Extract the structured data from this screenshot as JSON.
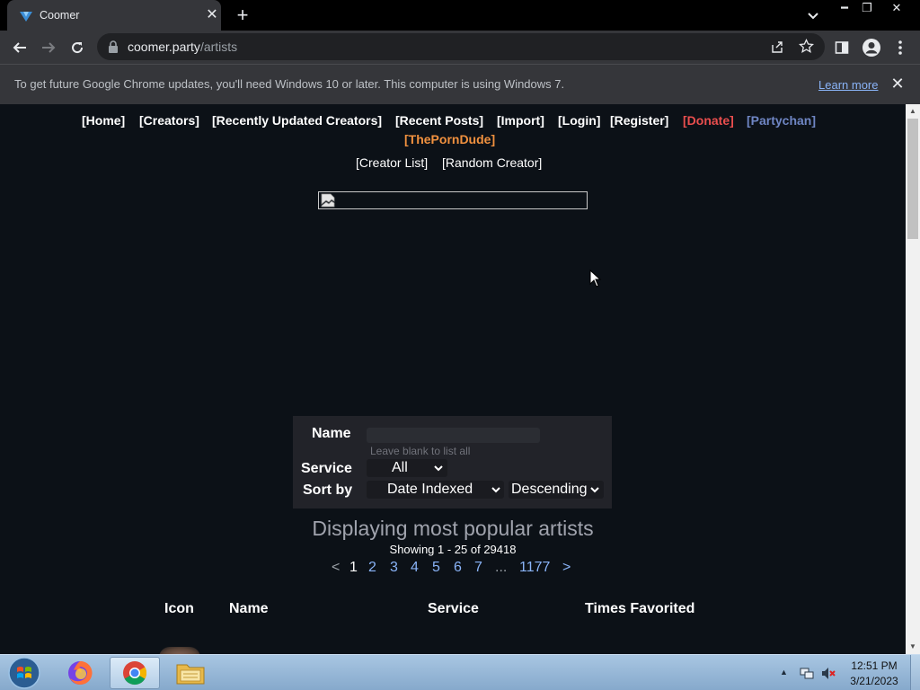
{
  "browser": {
    "tab": {
      "title": "Coomer"
    },
    "url": {
      "host": "coomer.party",
      "path": "/artists"
    },
    "infobar": {
      "message": "To get future Google Chrome updates, you'll need Windows 10 or later. This computer is using Windows 7.",
      "link": "Learn more"
    }
  },
  "site": {
    "nav": [
      {
        "label": "[Home]",
        "color": "#ffffff"
      },
      {
        "label": "[Creators]",
        "color": "#ffffff"
      },
      {
        "label": "[Recently Updated Creators]",
        "color": "#ffffff"
      },
      {
        "label": "[Recent Posts]",
        "color": "#ffffff"
      },
      {
        "label": "[Import]",
        "color": "#ffffff"
      },
      {
        "label": "[Login]",
        "color": "#ffffff"
      },
      {
        "label": "[Register]",
        "color": "#ffffff"
      },
      {
        "label": "[Donate]",
        "color": "#ea4e4e"
      },
      {
        "label": "[Partychan]",
        "color": "#6f86c4"
      },
      {
        "label": "[ThePornDude]",
        "color": "#f1913f"
      }
    ],
    "subnav": [
      "[Creator List]",
      "[Random Creator]"
    ]
  },
  "search": {
    "name_label": "Name",
    "name_value": "",
    "name_hint": "Leave blank to list all",
    "service_label": "Service",
    "service_value": "All",
    "sort_label": "Sort by",
    "sort_value": "Date Indexed",
    "order_value": "Descending"
  },
  "results": {
    "title": "Displaying most popular artists",
    "showing": "Showing 1 - 25 of 29418",
    "pager": {
      "prev": "<",
      "pages": [
        "1",
        "2",
        "3",
        "4",
        "5",
        "6",
        "7"
      ],
      "current": "1",
      "ellipsis": "...",
      "last": "1177",
      "next": ">"
    },
    "columns": [
      "Icon",
      "Name",
      "Service",
      "Times Favorited"
    ]
  },
  "taskbar": {
    "time": "12:51 PM",
    "date": "3/21/2023"
  }
}
